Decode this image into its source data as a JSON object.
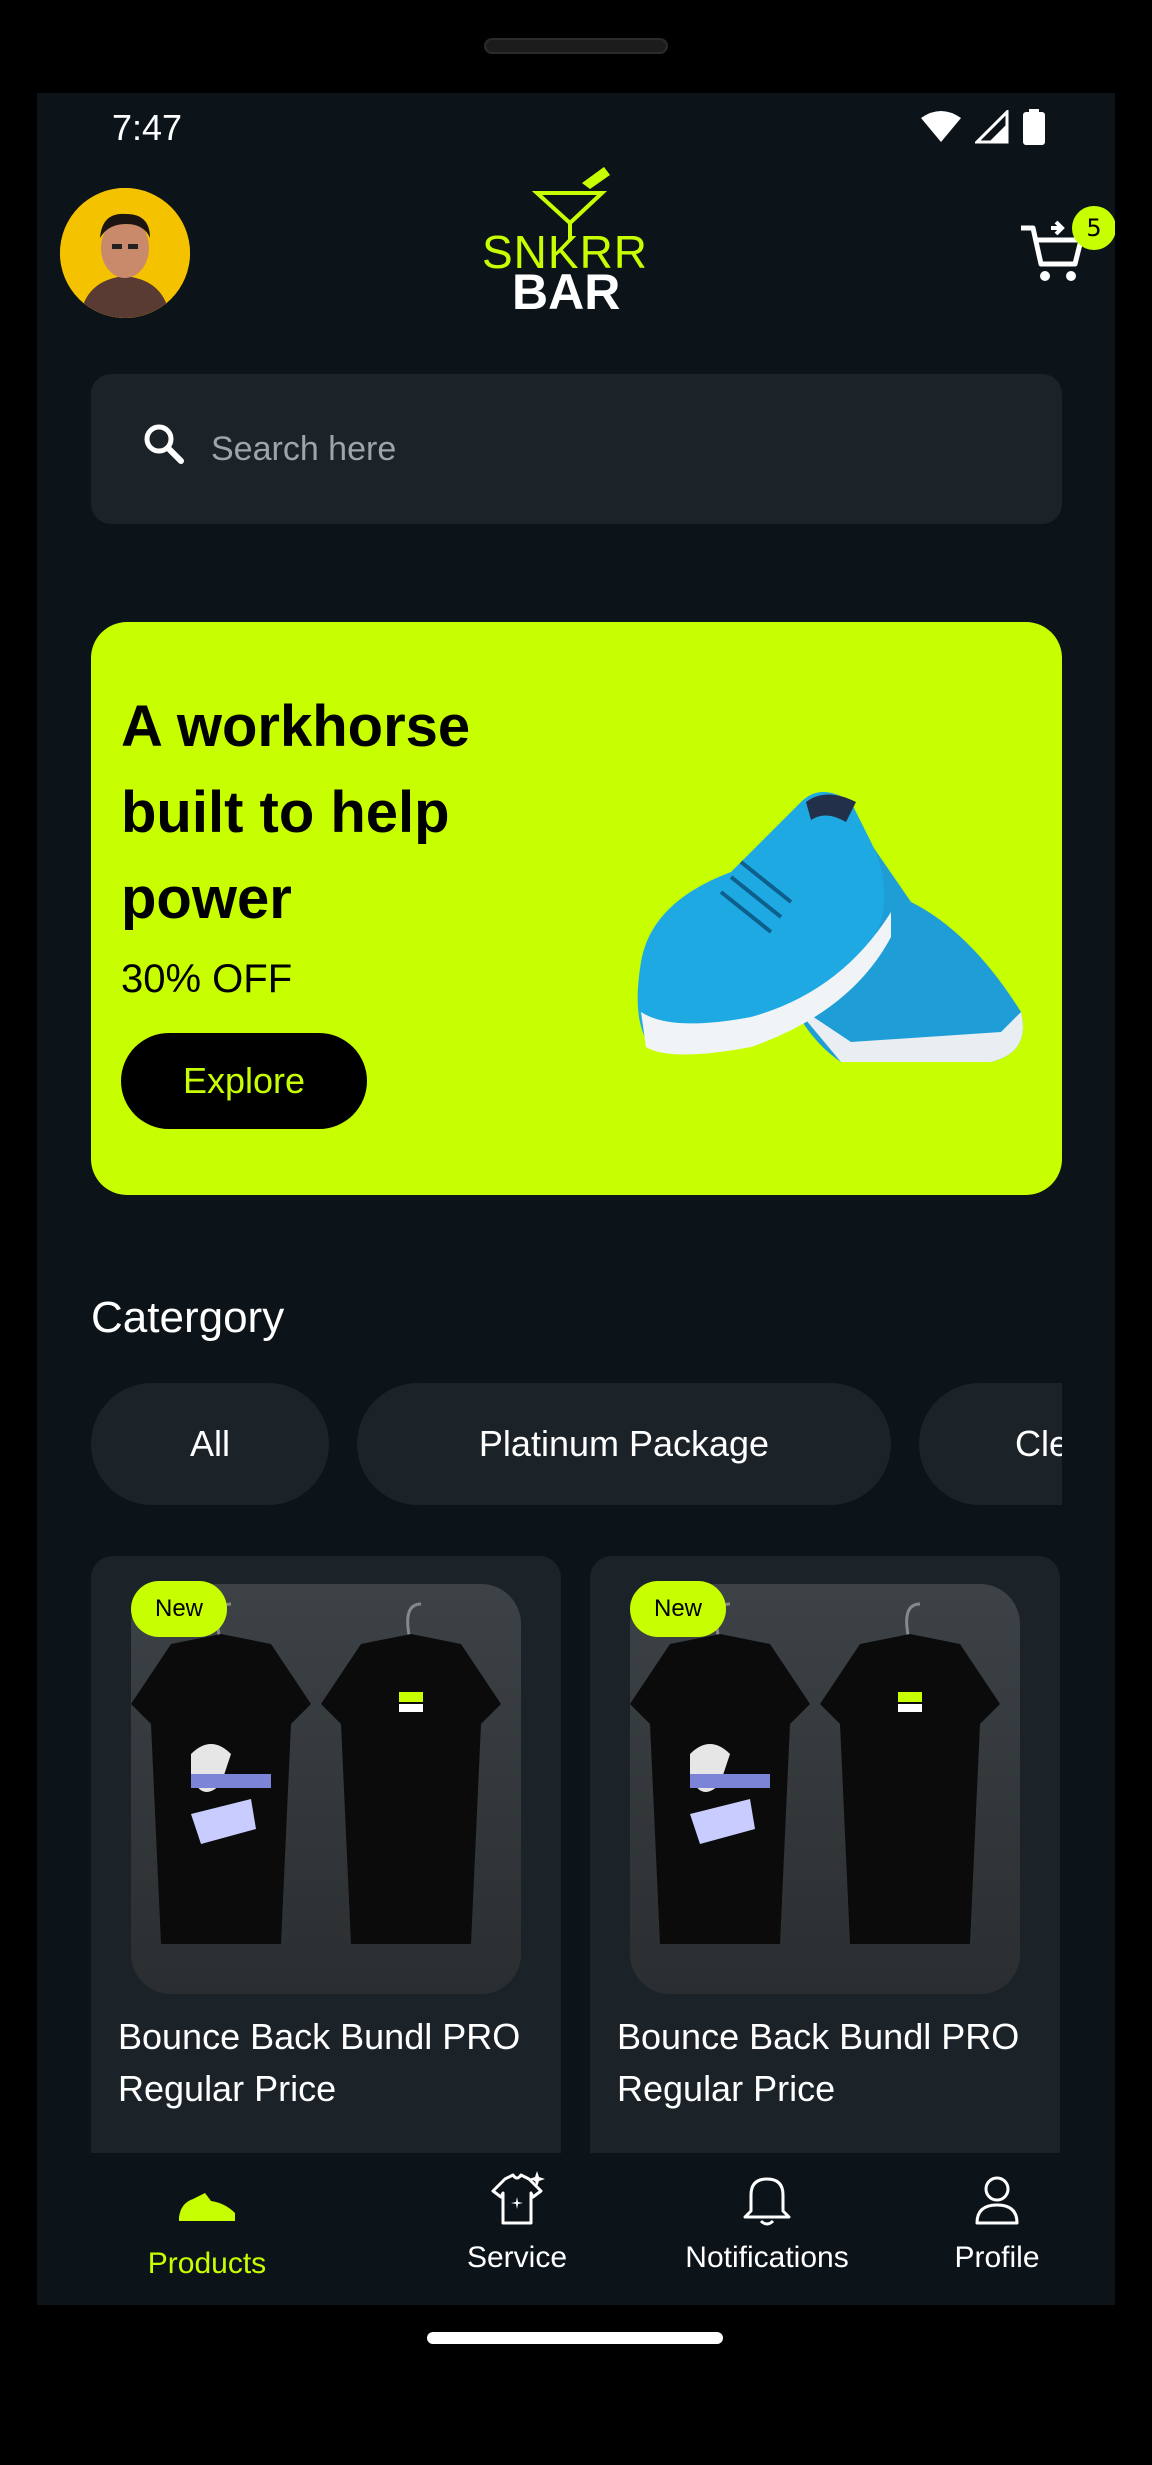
{
  "status_bar": {
    "time": "7:47"
  },
  "header": {
    "logo_top": "SNKRR",
    "logo_bottom": "BAR",
    "cart_count": "5"
  },
  "search": {
    "placeholder": "Search here"
  },
  "banner": {
    "title": "A workhorse built to help power",
    "discount": "30% OFF",
    "cta_label": "Explore"
  },
  "category": {
    "title": "Catergory",
    "chips": [
      "All",
      "Platinum Package",
      "Cle"
    ]
  },
  "products": [
    {
      "badge": "New",
      "name": "Bounce Back Bundl PRO Regular Price"
    },
    {
      "badge": "New",
      "name": "Bounce Back Bundl PRO Regular Price"
    }
  ],
  "bottom_nav": {
    "items": [
      {
        "label": "Products",
        "icon": "shoe-icon",
        "active": true
      },
      {
        "label": "Service",
        "icon": "tshirt-sparkle-icon",
        "active": false
      },
      {
        "label": "Notifications",
        "icon": "bell-icon",
        "active": false
      },
      {
        "label": "Profile",
        "icon": "user-icon",
        "active": false
      }
    ]
  },
  "colors": {
    "accent": "#c8ff00",
    "background": "#0d1419",
    "surface": "#1c2328"
  }
}
